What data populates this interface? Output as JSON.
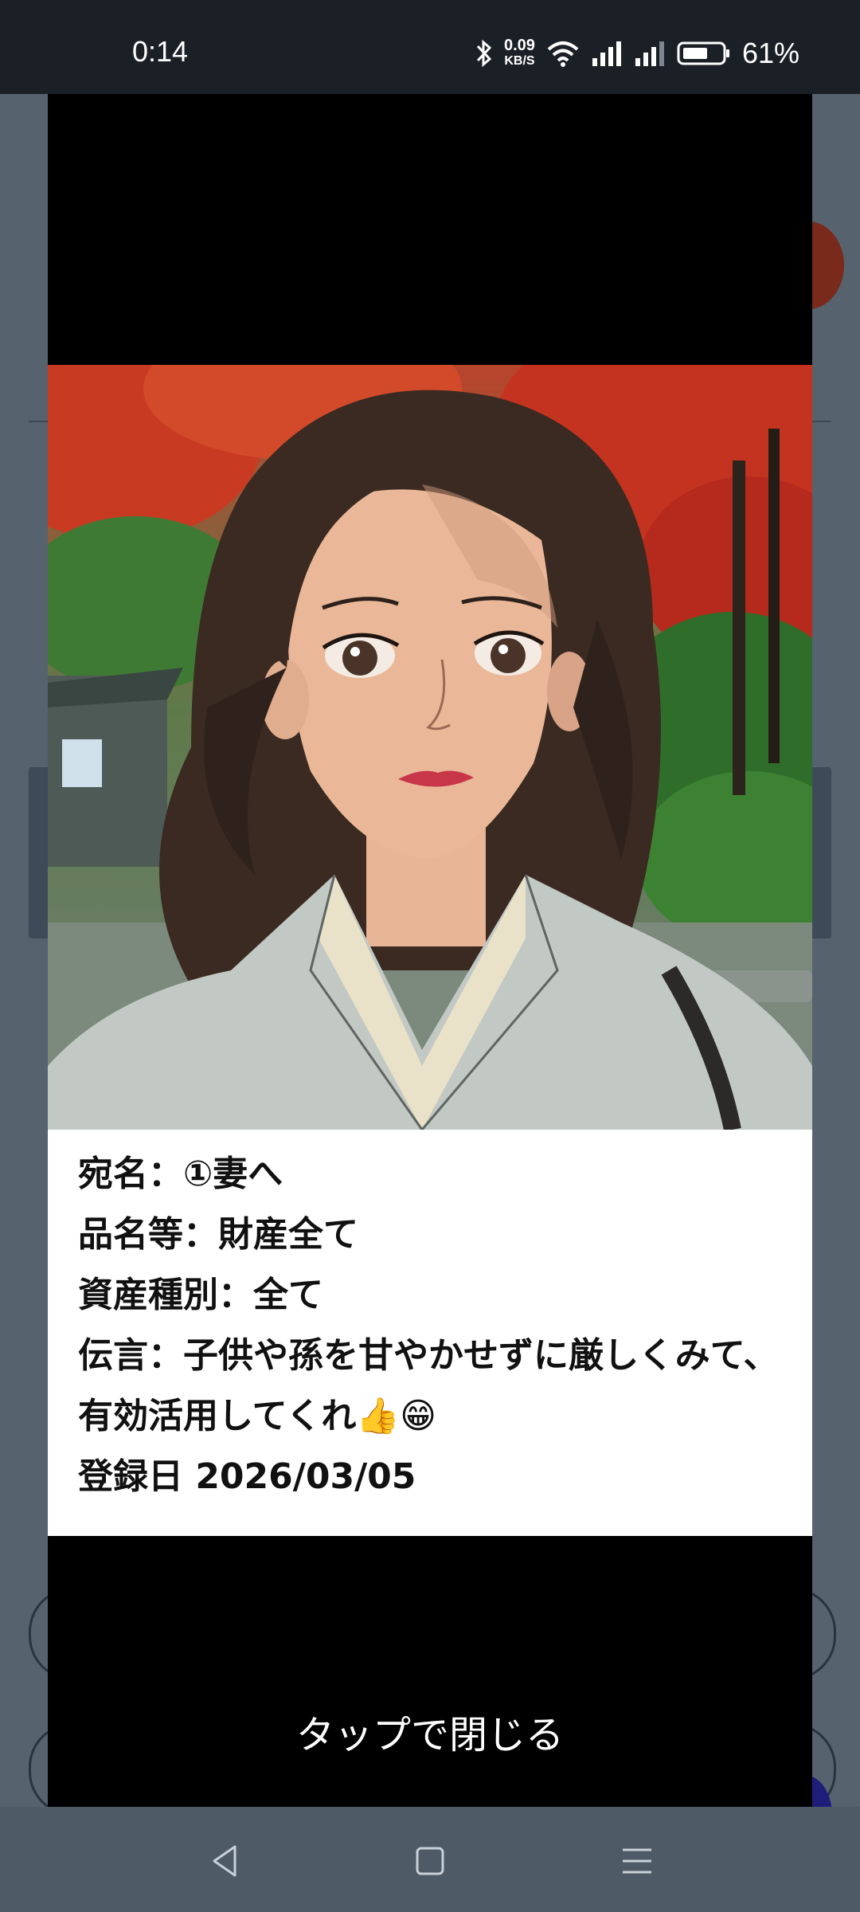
{
  "status": {
    "time": "0:14",
    "net_speed_value": "0.09",
    "net_speed_unit": "KB/S",
    "battery": "61%"
  },
  "modal": {
    "recipient": "宛名：①妻へ",
    "item": "品名等：財産全て",
    "asset_type": "資産種別：全て",
    "message": "伝言：子供や孫を甘やかせずに厳しくみて、有効活用してくれ👍😁",
    "registered": "登録日 2026/03/05",
    "close_hint": "タップで閉じる"
  },
  "colors": {
    "scrim": "#000000",
    "panel": "#ffffff",
    "status_bar": "#1b2026",
    "foliage_red": "#c83a22",
    "foliage_green": "#3f7a35"
  }
}
